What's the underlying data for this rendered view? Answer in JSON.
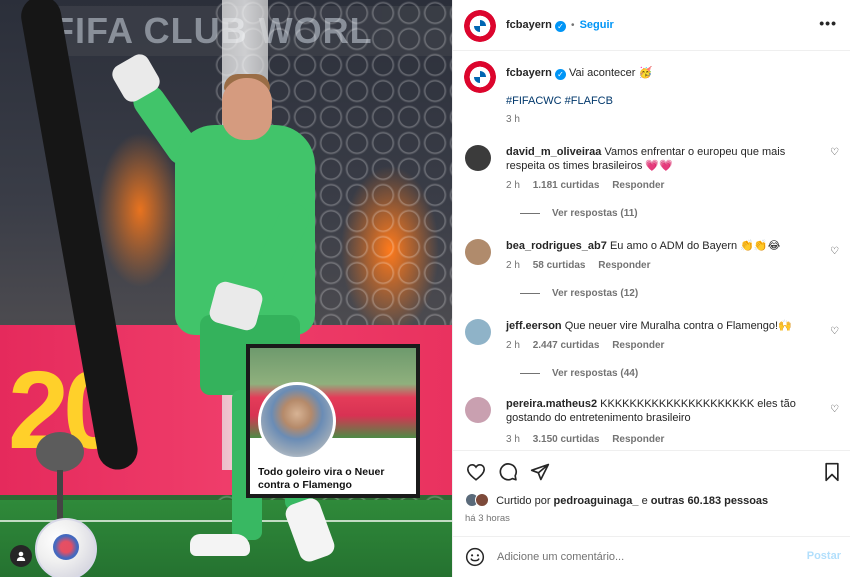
{
  "photo": {
    "banner_text": "FIFA CLUB WORL",
    "adboard_text": "20",
    "overlay": {
      "caption": "Todo goleiro vira o Neuer contra o Flamengo"
    },
    "tagged_icon": "person-icon"
  },
  "header": {
    "username": "fcbayern",
    "verified_icon": "verified-badge-icon",
    "separator": "•",
    "follow_label": "Seguir",
    "more_icon": "more-options-icon",
    "more_glyph": "•••"
  },
  "caption": {
    "username": "fcbayern",
    "text": "Vai acontecer 🥳",
    "hashtags": "#FIFACWC #FLAFCB",
    "time": "3 h"
  },
  "comments": [
    {
      "username": "david_m_oliveiraa",
      "text": "Vamos enfrentar o europeu que mais respeita os times brasileiros 💗💗",
      "time": "2 h",
      "likes": "1.181 curtidas",
      "reply": "Responder",
      "view_replies": "Ver respostas (11)",
      "avatar_color": "#3b3b3b"
    },
    {
      "username": "bea_rodrigues_ab7",
      "text": "Eu amo o ADM do Bayern 👏👏😂",
      "time": "2 h",
      "likes": "58 curtidas",
      "reply": "Responder",
      "view_replies": "Ver respostas (12)",
      "avatar_color": "#b08b6c"
    },
    {
      "username": "jeff.eerson",
      "text": "Que neuer vire Muralha contra o Flamengo!🙌",
      "time": "2 h",
      "likes": "2.447 curtidas",
      "reply": "Responder",
      "view_replies": "Ver respostas (44)",
      "avatar_color": "#8fb3c8"
    },
    {
      "username": "pereira.matheus2",
      "text": "KKKKKKKKKKKKKKKKKKKKK eles tão gostando do entretenimento brasileiro",
      "time": "3 h",
      "likes": "3.150 curtidas",
      "reply": "Responder",
      "avatar_color": "#c9a0b0"
    }
  ],
  "actions": {
    "like_icon": "heart-icon",
    "comment_icon": "comment-icon",
    "share_icon": "share-icon",
    "save_icon": "bookmark-icon"
  },
  "likes": {
    "prefix": "Curtido por",
    "user": "pedroaguinaga_",
    "connector": "e",
    "others": "outras 60.183 pessoas"
  },
  "timeago": "há 3 horas",
  "composer": {
    "emoji_icon": "emoji-icon",
    "placeholder": "Adicione um comentário...",
    "post_label": "Postar"
  },
  "colors": {
    "accent": "#0095f6",
    "brand_red": "#dc052d"
  }
}
